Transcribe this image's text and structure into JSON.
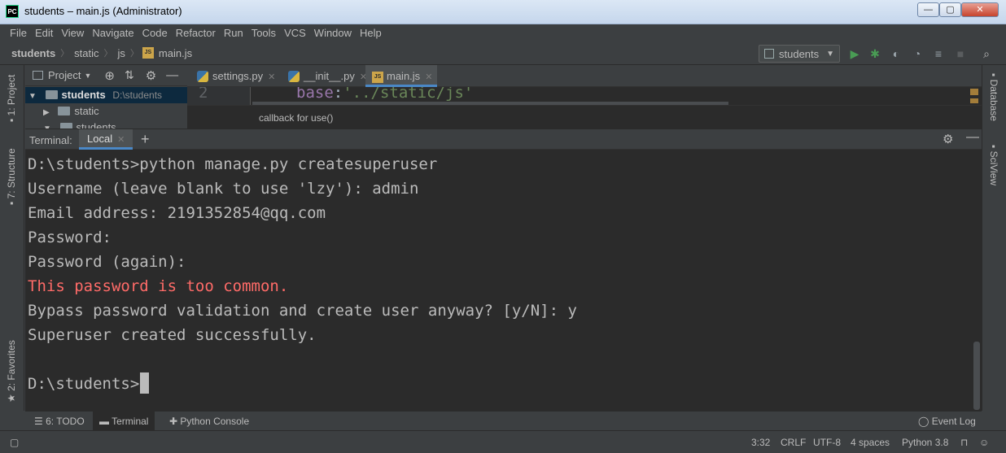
{
  "window": {
    "logo": "PC",
    "title": "students – main.js (Administrator)",
    "min": "—",
    "max": "▢",
    "close": "✕"
  },
  "menu": [
    "File",
    "Edit",
    "View",
    "Navigate",
    "Code",
    "Refactor",
    "Run",
    "Tools",
    "VCS",
    "Window",
    "Help"
  ],
  "navbar": {
    "crumbs": [
      "students",
      "static",
      "js",
      "main.js"
    ],
    "run_config": "students",
    "search_icon": "search-icon"
  },
  "left_strip": {
    "project": "1: Project",
    "structure": "7: Structure",
    "favorites": "2: Favorites"
  },
  "right_strip": {
    "database": "Database",
    "sciview": "SciView"
  },
  "project_panel": {
    "title": "Project",
    "root": "students",
    "root_path": "D:\\students",
    "child1": "static",
    "child2": "students"
  },
  "editor": {
    "tabs": [
      {
        "label": "settings.py"
      },
      {
        "label": "__init__.py"
      },
      {
        "label": "main.js"
      }
    ],
    "line_number": "2",
    "code_key": "base",
    "code_colon": ":",
    "code_str": "'../static/js'",
    "breadcrumb": "callback for use()"
  },
  "terminal": {
    "label": "Terminal:",
    "tab": "Local",
    "lines": [
      "D:\\students>python manage.py createsuperuser",
      "Username (leave blank to use 'lzy'): admin",
      "Email address: 2191352854@qq.com",
      "Password:",
      "Password (again):",
      "This password is too common.",
      "Bypass password validation and create user anyway? [y/N]: y",
      "Superuser created successfully.",
      "",
      "D:\\students>"
    ]
  },
  "bottom_tabs": {
    "todo": "6: TODO",
    "terminal": "Terminal",
    "python_console": "Python Console",
    "event_log": "Event Log"
  },
  "status": {
    "position": "3:32",
    "line_sep": "CRLF",
    "encoding": "UTF-8",
    "indent": "4 spaces",
    "interpreter": "Python 3.8"
  },
  "colors": {
    "background": "#3c3f41",
    "editor_bg": "#2b2b2b",
    "error_text": "#ff6b68",
    "run_green": "#499c54",
    "accent_blue": "#4a88c7"
  }
}
